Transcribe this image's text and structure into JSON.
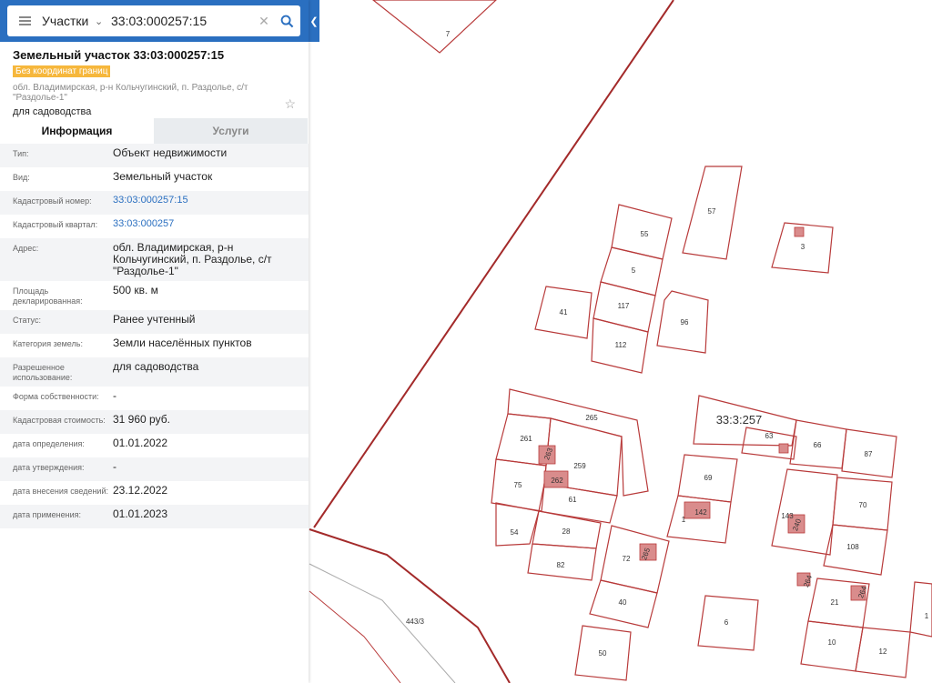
{
  "search": {
    "category": "Участки",
    "query": "33:03:000257:15"
  },
  "object": {
    "title": "Земельный участок 33:03:000257:15",
    "badge": "Без координат границ",
    "address_short": "обл. Владимирская, р-н Кольчугинский, п. Раздолье, с/т \"Раздолье-1\"",
    "usage": "для садоводства"
  },
  "tabs": [
    {
      "label": "Информация",
      "active": true
    },
    {
      "label": "Услуги",
      "active": false
    }
  ],
  "info": [
    {
      "label": "Тип:",
      "value": "Объект недвижимости"
    },
    {
      "label": "Вид:",
      "value": "Земельный участок"
    },
    {
      "label": "Кадастровый номер:",
      "value": "33:03:000257:15",
      "link": true
    },
    {
      "label": "Кадастровый квартал:",
      "value": "33:03:000257",
      "link": true
    },
    {
      "label": "Адрес:",
      "value": "обл. Владимирская, р-н Кольчугинский, п. Раздолье, с/т \"Раздолье-1\""
    },
    {
      "label": "Площадь декларированная:",
      "value": "500 кв. м"
    },
    {
      "label": "Статус:",
      "value": "Ранее учтенный"
    },
    {
      "label": "Категория земель:",
      "value": "Земли населённых пунктов"
    },
    {
      "label": "Разрешенное использование:",
      "value": "для садоводства"
    },
    {
      "label": "Форма собственности:",
      "value": "-"
    },
    {
      "label": "Кадастровая стоимость:",
      "value": "31 960 руб."
    },
    {
      "label": "дата определения:",
      "value": "01.01.2022"
    },
    {
      "label": "дата утверждения:",
      "value": "-"
    },
    {
      "label": "дата внесения сведений:",
      "value": "23.12.2022"
    },
    {
      "label": "дата применения:",
      "value": "01.01.2023"
    }
  ],
  "map": {
    "quarter_label": "33:3:257",
    "road_label": "443/3",
    "parcel_labels": [
      "7",
      "57",
      "55",
      "3",
      "5",
      "41",
      "117",
      "96",
      "112",
      "265",
      "261",
      "259",
      "75",
      "61",
      "54",
      "28",
      "82",
      "72",
      "40",
      "50",
      "69",
      "1",
      "63",
      "66",
      "87",
      "143",
      "70",
      "108",
      "21",
      "10",
      "12",
      "6",
      "264",
      "262",
      "263",
      "142",
      "240",
      "264",
      "265"
    ],
    "colors": {
      "parcel": "#c0392b",
      "road": "#a83232",
      "fill": "#d98c8c"
    }
  }
}
